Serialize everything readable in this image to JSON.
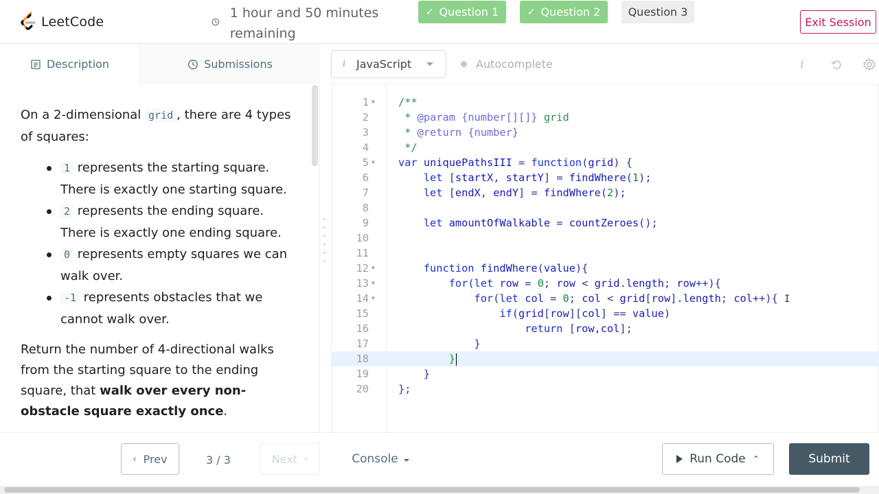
{
  "header": {
    "logo_text": "LeetCode",
    "timer_text": "1 hour and 50 minutes remaining",
    "questions": [
      {
        "label": "Question 1",
        "state": "done"
      },
      {
        "label": "Question 2",
        "state": "done"
      },
      {
        "label": "Question 3",
        "state": "current"
      }
    ],
    "exit_label": "Exit Session"
  },
  "left_tabs": {
    "description": "Description",
    "submissions": "Submissions"
  },
  "problem": {
    "intro_a": "On a 2-dimensional",
    "intro_code": "grid",
    "intro_b": ", there are 4 types of squares:",
    "items": [
      {
        "code": "1",
        "text": "represents the starting square. There is exactly one starting square."
      },
      {
        "code": "2",
        "text": "represents the ending square. There is exactly one ending square."
      },
      {
        "code": "0",
        "text": "represents empty squares we can walk over."
      },
      {
        "code": "-1",
        "text": "represents obstacles that we cannot walk over."
      }
    ],
    "return_a": "Return the number of 4-directional walks from the starting square to the ending square, that",
    "return_bold": "walk over every non-obstacle square exactly once",
    "return_b": "."
  },
  "editor": {
    "language": "JavaScript",
    "autocomplete_label": "Autocomplete",
    "active_line": 18,
    "lines": [
      "/**",
      " * @param {number[][]} grid",
      " * @return {number}",
      " */",
      "var uniquePathsIII = function(grid) {",
      "    let [startX, startY] = findWhere(1);",
      "    let [endX, endY] = findWhere(2);",
      "",
      "    let amountOfWalkable = countZeroes();",
      "",
      "",
      "    function findWhere(value){",
      "        for(let row = 0; row < grid.length; row++){",
      "            for(let col = 0; col < grid[row].length; col++){",
      "                if(grid[row][col] == value)",
      "                    return [row,col];",
      "            }",
      "        }",
      "    }",
      "};"
    ]
  },
  "bottom": {
    "prev_label": "Prev",
    "page_indicator": "3 / 3",
    "next_label": "Next",
    "console_label": "Console",
    "run_label": "Run Code",
    "submit_label": "Submit"
  },
  "colors": {
    "done_question": "#8dd28a",
    "exit": "#c2185b",
    "submit_bg": "#455a64"
  }
}
